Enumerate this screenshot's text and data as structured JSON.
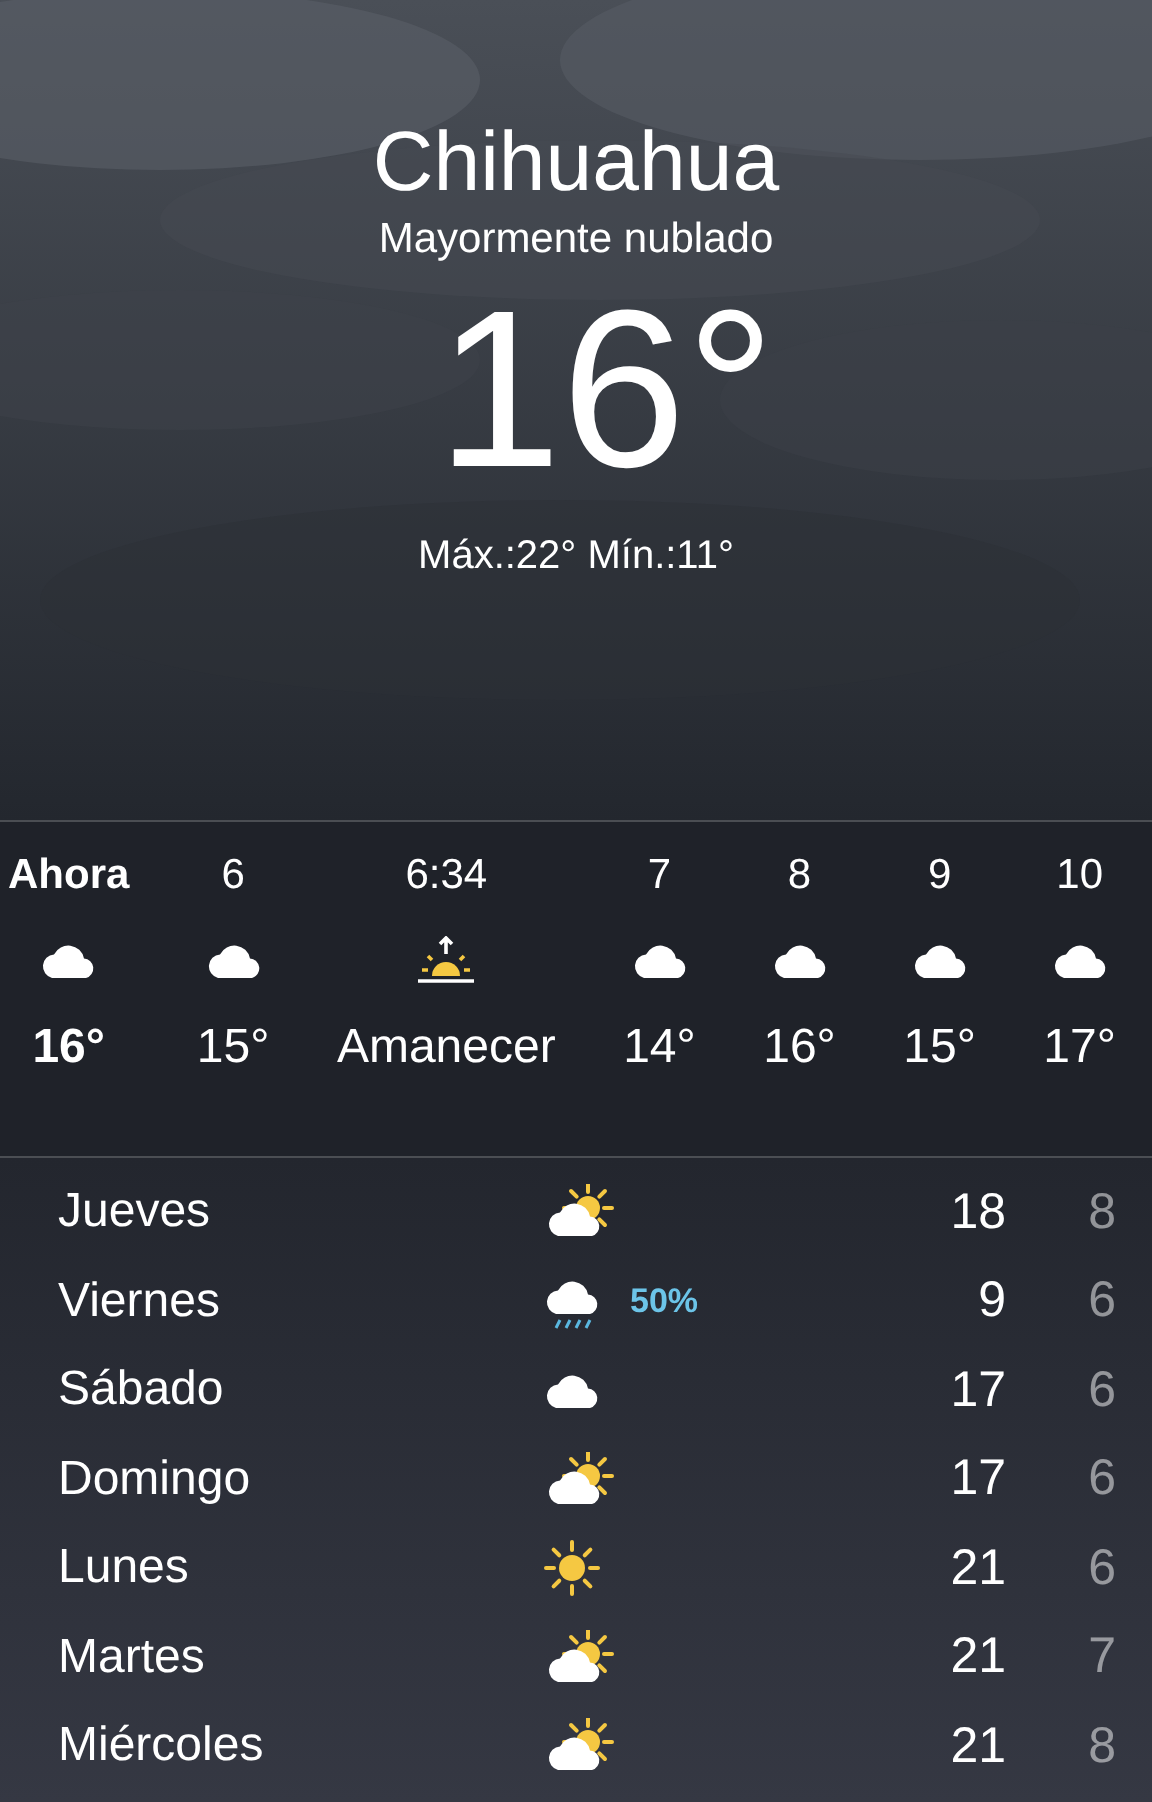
{
  "location": {
    "city": "Chihuahua",
    "condition": "Mayormente nublado",
    "temperature": "16°",
    "high_low": "Máx.:22° Mín.:11°"
  },
  "hourly": [
    {
      "time": "Ahora",
      "kind": "cloud",
      "temp": "16°",
      "current": true
    },
    {
      "time": "6",
      "kind": "cloud",
      "temp": "15°",
      "current": false
    },
    {
      "time": "6:34",
      "kind": "sunrise",
      "temp": "Amanecer",
      "current": false
    },
    {
      "time": "7",
      "kind": "cloud",
      "temp": "14°",
      "current": false
    },
    {
      "time": "8",
      "kind": "cloud",
      "temp": "16°",
      "current": false
    },
    {
      "time": "9",
      "kind": "cloud",
      "temp": "15°",
      "current": false
    },
    {
      "time": "10",
      "kind": "cloud",
      "temp": "17°",
      "current": false
    }
  ],
  "daily": [
    {
      "day": "Jueves",
      "kind": "partly_sunny",
      "high": "18",
      "low": "8"
    },
    {
      "day": "Viernes",
      "kind": "rain",
      "precipitation": "50%",
      "high": "9",
      "low": "6"
    },
    {
      "day": "Sábado",
      "kind": "cloud",
      "high": "17",
      "low": "6"
    },
    {
      "day": "Domingo",
      "kind": "partly_sunny",
      "high": "17",
      "low": "6"
    },
    {
      "day": "Lunes",
      "kind": "sun",
      "high": "21",
      "low": "6"
    },
    {
      "day": "Martes",
      "kind": "partly_sunny",
      "high": "21",
      "low": "7"
    },
    {
      "day": "Miércoles",
      "kind": "partly_sunny",
      "high": "21",
      "low": "8"
    }
  ]
}
